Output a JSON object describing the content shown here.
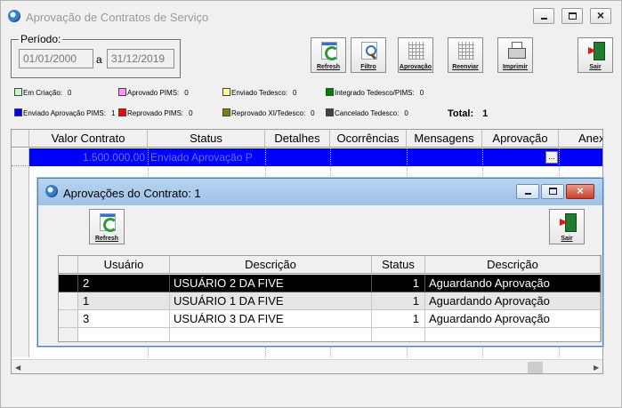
{
  "main": {
    "title": "Aprovação de Contratos de Serviço",
    "periodo": {
      "label": "Período:",
      "start": "01/01/2000",
      "sep": "a",
      "end": "31/12/2019"
    },
    "toolbar": {
      "refresh": "Refresh",
      "filtro": "Filtro",
      "aprovacao": "Aprovação",
      "reenviar": "Reenviar",
      "imprimir": "Imprimir",
      "sair": "Sair"
    },
    "legend": [
      {
        "label": "Em Criação:",
        "count": "0",
        "color": "#c8f5c8"
      },
      {
        "label": "Aprovado PIMS:",
        "count": "0",
        "color": "#ff90ff"
      },
      {
        "label": "Enviado Tedesco:",
        "count": "0",
        "color": "#ffff90"
      },
      {
        "label": "Integrado Tedesco/PIMS:",
        "count": "0",
        "color": "#008000"
      },
      {
        "label": "Enviado Aprovação PIMS:",
        "count": "1",
        "color": "#0000ff"
      },
      {
        "label": "Reprovado PIMS:",
        "count": "0",
        "color": "#ff0000"
      },
      {
        "label": "Reprovado XI/Tedesco:",
        "count": "0",
        "color": "#808000"
      },
      {
        "label": "Cancelado Tedesco:",
        "count": "0",
        "color": "#404040"
      }
    ],
    "total": {
      "label": "Total:",
      "value": "1"
    },
    "grid": {
      "columns": [
        "Valor Contrato",
        "Status",
        "Detalhes",
        "Ocorrências",
        "Mensagens",
        "Aprovação",
        "Anex"
      ],
      "rows": [
        {
          "valor": "1.500.000,00",
          "status": "Enviado Aprovação P",
          "aprovacao_btn": "..."
        }
      ]
    }
  },
  "child": {
    "title": "Aprovações do Contrato: 1",
    "toolbar": {
      "refresh": "Refresh",
      "sair": "Sair"
    },
    "grid": {
      "columns": [
        "Usuário",
        "Descrição",
        "Status",
        "Descrição"
      ],
      "rows": [
        {
          "usuario": "2",
          "descricao": "USUÁRIO 2 DA FIVE",
          "status": "1",
          "status_desc": "Aguardando Aprovação"
        },
        {
          "usuario": "1",
          "descricao": "USUÁRIO 1 DA FIVE",
          "status": "1",
          "status_desc": "Aguardando Aprovação"
        },
        {
          "usuario": "3",
          "descricao": "USUÁRIO 3 DA FIVE",
          "status": "1",
          "status_desc": "Aguardando Aprovação"
        }
      ]
    }
  },
  "colors": {
    "selection_blue": "#0000ff",
    "selection_black": "#000000",
    "child_title": "#b8d3ef"
  }
}
